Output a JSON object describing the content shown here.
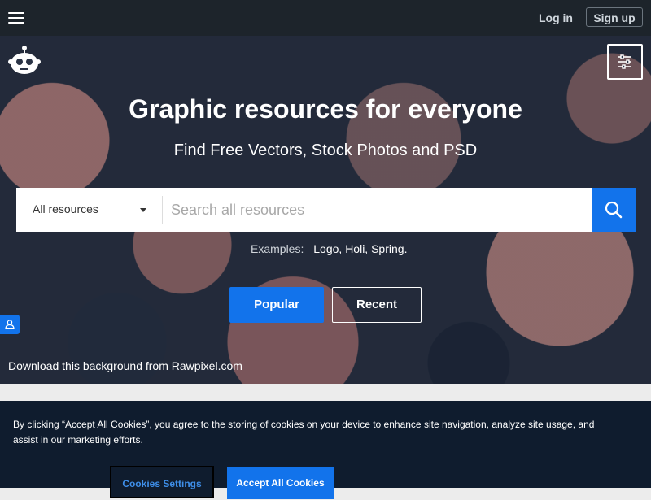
{
  "header": {
    "menu_icon": "hamburger-menu-icon",
    "login_label": "Log in",
    "signup_label": "Sign up"
  },
  "hero": {
    "logo_icon": "robot-logo-icon",
    "filter_icon": "sliders-filter-icon",
    "title": "Graphic resources for everyone",
    "subtitle": "Find Free Vectors, Stock Photos and PSD",
    "search": {
      "category_selected": "All resources",
      "placeholder": "Search all resources",
      "search_icon": "search-icon"
    },
    "examples": {
      "label": "Examples:",
      "items": [
        "Logo,",
        "Holi,",
        "Spring."
      ]
    },
    "buttons": {
      "popular": "Popular",
      "recent": "Recent"
    },
    "side_icon": "person-icon",
    "credit": "Download this background from Rawpixel.com"
  },
  "cookie_banner": {
    "text": "By clicking “Accept All Cookies”, you agree to the storing of cookies on your device to enhance site navigation, analyze site usage, and assist in our marketing efforts.",
    "settings_label": "Cookies Settings",
    "accept_label": "Accept All Cookies"
  },
  "colors": {
    "brand_blue": "#1273eb",
    "topbar_bg": "#1d242b",
    "cookie_bg": "#0f1c2e"
  }
}
